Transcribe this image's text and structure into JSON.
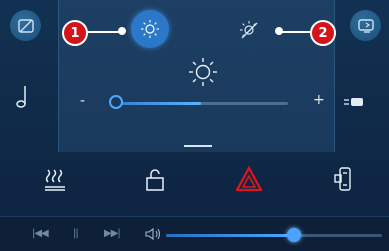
{
  "callouts": {
    "first": "1",
    "second": "2"
  },
  "display_mode": {
    "selected": "day",
    "options": [
      "day",
      "night"
    ]
  },
  "brightness": {
    "level": 0.05,
    "minus_label": "-",
    "plus_label": "+"
  },
  "media": {
    "prev_label": "|◀◀",
    "pause_label": "||",
    "next_label": "▶▶|",
    "volume_level": 0.57
  },
  "colors": {
    "accent": "#2b78c8",
    "hazard": "#e0141b",
    "callout": "#d4131b"
  },
  "icons": {
    "top_left": "screen-off-icon",
    "top_right": "screen-switch-icon",
    "day": "sun-icon",
    "night": "sun-off-icon",
    "brightness": "sun-icon",
    "left_side": "music-note-icon",
    "right_side": "light-indicator-icon",
    "functions": [
      "rear-heating-icon",
      "unlock-icon",
      "hazard-warning-icon",
      "seat-settings-icon"
    ],
    "volume": "speaker-icon"
  }
}
